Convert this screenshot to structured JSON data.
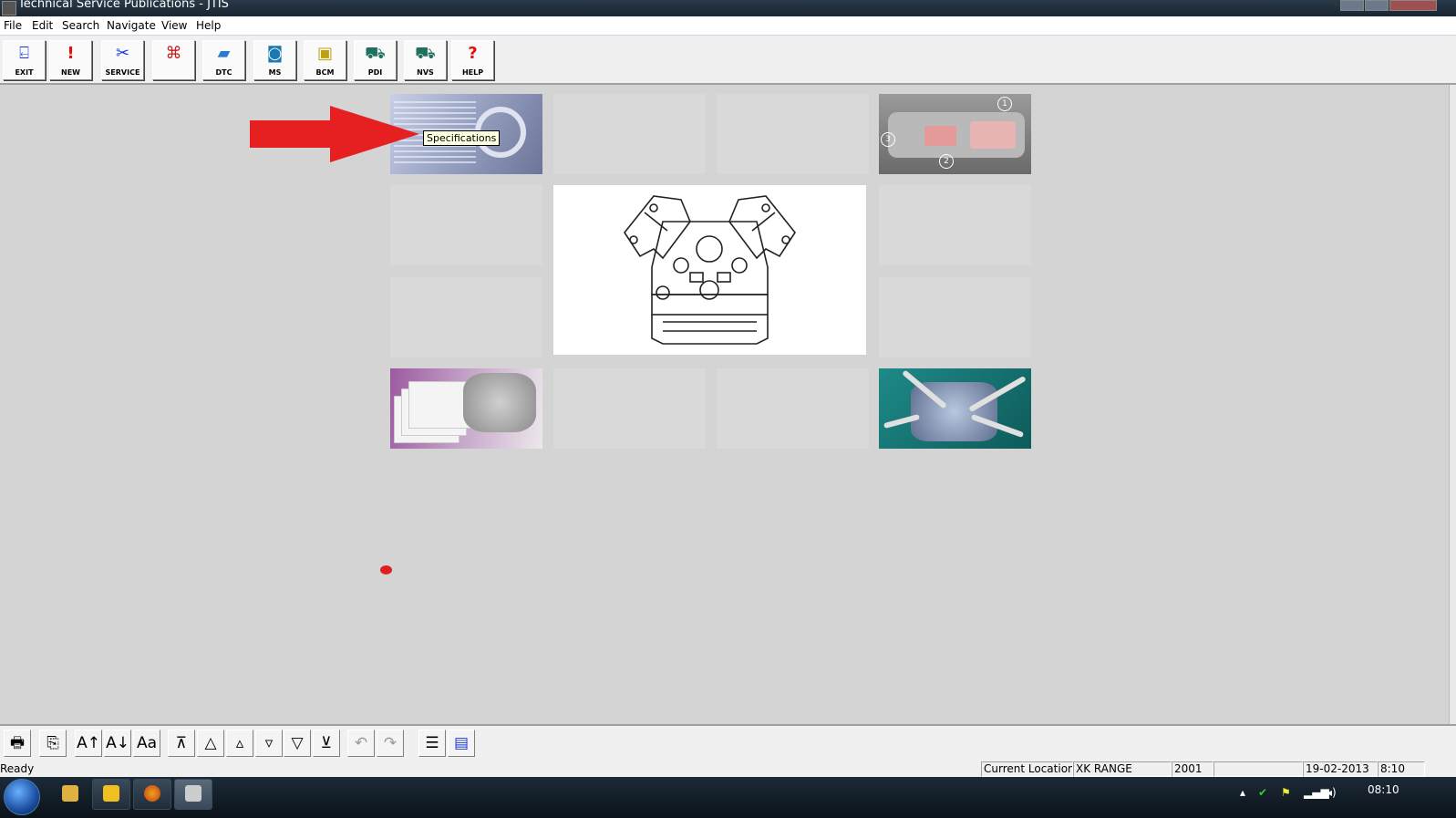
{
  "window": {
    "title": "Technical Service Publications - JTIS"
  },
  "menu": [
    "File",
    "Edit",
    "Search",
    "Navigate",
    "View",
    "Help"
  ],
  "toolbar": [
    {
      "label": "EXIT",
      "icon": "exit-door-icon"
    },
    {
      "label": "NEW",
      "icon": "exclamation-icon"
    },
    {
      "label": "SERVICE",
      "icon": "wrench-icon"
    },
    {
      "label": "",
      "icon": "connector-icon"
    },
    {
      "label": "DTC",
      "icon": "dtc-scanner-icon"
    },
    {
      "label": "MS",
      "icon": "ms-machine-icon"
    },
    {
      "label": "BCM",
      "icon": "bcm-module-icon"
    },
    {
      "label": "PDI",
      "icon": "pdi-car-icon"
    },
    {
      "label": "NVS",
      "icon": "nvs-car-icon"
    },
    {
      "label": "HELP",
      "icon": "help-question-icon"
    }
  ],
  "tooltip": "Specifications",
  "dashboard_numbers": [
    "1",
    "2",
    "3"
  ],
  "bottom_toolbar": [
    {
      "name": "print-button",
      "glyph": "🖶"
    },
    {
      "name": "copy-button",
      "glyph": "⎘"
    },
    {
      "name": "font-increase-button",
      "glyph": "A↑"
    },
    {
      "name": "font-decrease-button",
      "glyph": "A↓"
    },
    {
      "name": "font-style-button",
      "glyph": "Aa"
    },
    {
      "name": "first-page-button",
      "glyph": "⊼"
    },
    {
      "name": "previous-section-button",
      "glyph": "△"
    },
    {
      "name": "previous-page-button",
      "glyph": "▵"
    },
    {
      "name": "next-page-button",
      "glyph": "▿"
    },
    {
      "name": "next-section-button",
      "glyph": "▽"
    },
    {
      "name": "last-page-button",
      "glyph": "⊻"
    },
    {
      "name": "back-button",
      "glyph": "↶"
    },
    {
      "name": "forward-button",
      "glyph": "↷"
    },
    {
      "name": "contents-list-button",
      "glyph": "☰"
    },
    {
      "name": "document-view-button",
      "glyph": "▤"
    }
  ],
  "status": {
    "ready": "Ready",
    "location_label": "Current Location",
    "model": "XK RANGE",
    "year": "2001",
    "blank": "",
    "date": "19-02-2013",
    "time": "8:10"
  },
  "taskbar": {
    "clock": "08:10"
  }
}
